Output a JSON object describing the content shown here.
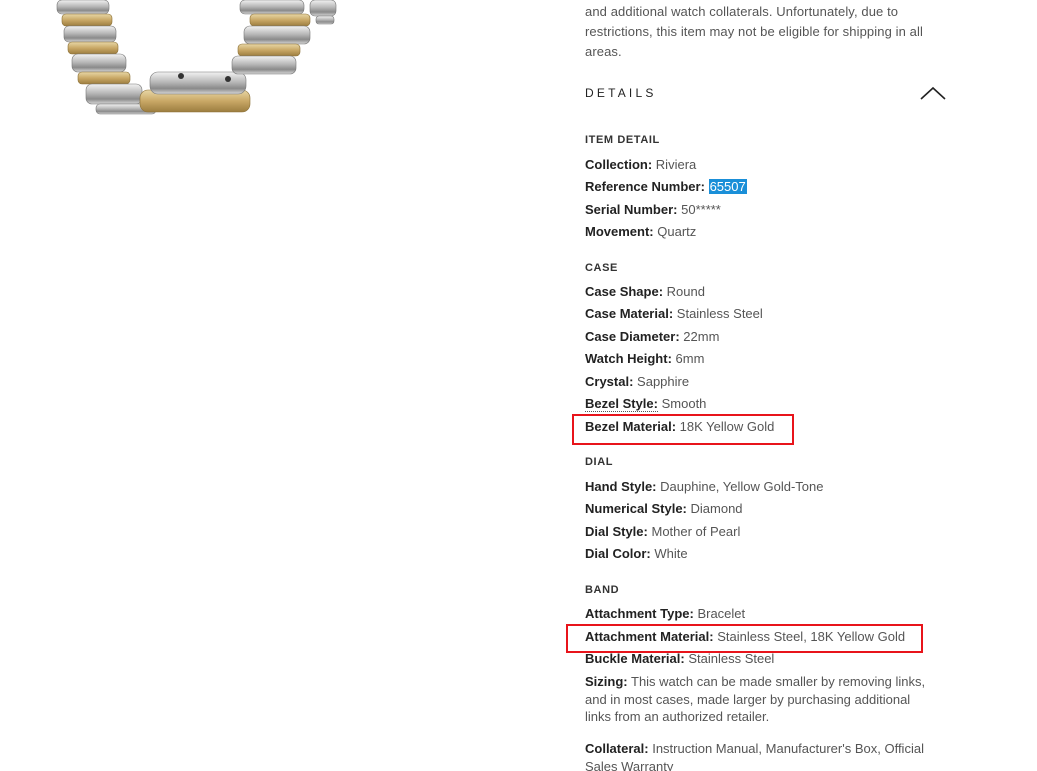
{
  "intro_text": "and additional watch collaterals. Unfortunately, due to restrictions, this item may not be eligible for shipping in all areas.",
  "details_title": "DETAILS",
  "sections": {
    "item_detail": {
      "title": "ITEM DETAIL",
      "rows": [
        {
          "label": "Collection:",
          "value": "Riviera"
        },
        {
          "label": "Reference Number:",
          "value": "65507"
        },
        {
          "label": "Serial Number:",
          "value": "50*****"
        },
        {
          "label": "Movement:",
          "value": "Quartz"
        }
      ]
    },
    "case": {
      "title": "CASE",
      "rows": [
        {
          "label": "Case Shape:",
          "value": "Round"
        },
        {
          "label": "Case Material:",
          "value": "Stainless Steel"
        },
        {
          "label": "Case Diameter:",
          "value": "22mm"
        },
        {
          "label": "Watch Height:",
          "value": "6mm"
        },
        {
          "label": "Crystal:",
          "value": "Sapphire"
        },
        {
          "label": "Bezel Style:",
          "value": "Smooth"
        },
        {
          "label": "Bezel Material:",
          "value": "18K Yellow Gold"
        }
      ]
    },
    "dial": {
      "title": "DIAL",
      "rows": [
        {
          "label": "Hand Style:",
          "value": "Dauphine, Yellow Gold-Tone"
        },
        {
          "label": "Numerical Style:",
          "value": "Diamond"
        },
        {
          "label": "Dial Style:",
          "value": "Mother of Pearl"
        },
        {
          "label": "Dial Color:",
          "value": "White"
        }
      ]
    },
    "band": {
      "title": "BAND",
      "rows": [
        {
          "label": "Attachment Type:",
          "value": "Bracelet"
        },
        {
          "label": "Attachment Material:",
          "value": "Stainless Steel, 18K Yellow Gold"
        },
        {
          "label": "Buckle Material:",
          "value": "Stainless Steel"
        }
      ],
      "sizing_label": "Sizing:",
      "sizing_text": "This watch can be made smaller by removing links, and in most cases, made larger by purchasing additional links from an authorized retailer.",
      "collateral_label": "Collateral:",
      "collateral_text": "Instruction Manual, Manufacturer's Box, Official Sales Warranty"
    }
  },
  "colors": {
    "highlight": "#1a8fd8",
    "annotation_box": "#e8141b"
  },
  "icons": {
    "collapse": "chevron-up-icon",
    "product": "watch-bracelet-image"
  }
}
